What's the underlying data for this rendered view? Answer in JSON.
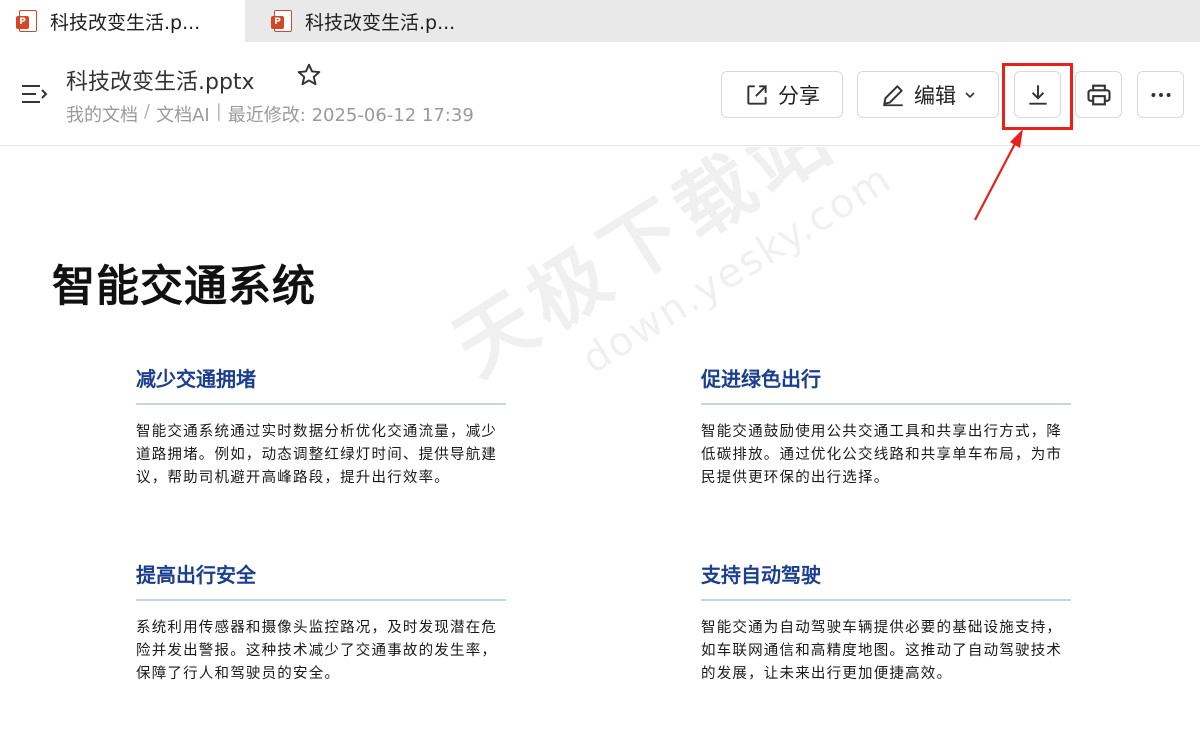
{
  "tabs": [
    {
      "label": "科技改变生活.p...",
      "icon": "powerpoint-file-icon"
    },
    {
      "label": "科技改变生活.p...",
      "icon": "powerpoint-file-icon"
    }
  ],
  "header": {
    "title": "科技改变生活.pptx",
    "breadcrumb": {
      "root": "我的文档",
      "sep1": "/",
      "folder": "文档AI",
      "sep2": "|",
      "modified": "最近修改: 2025-06-12 17:39"
    },
    "buttons": {
      "share": "分享",
      "edit": "编辑"
    }
  },
  "annotation": {
    "highlight_color": "#e8211a"
  },
  "slide": {
    "title": "智能交通系统",
    "sections": [
      {
        "heading": "减少交通拥堵",
        "body": "智能交通系统通过实时数据分析优化交通流量，减少道路拥堵。例如，动态调整红绿灯时间、提供导航建议，帮助司机避开高峰路段，提升出行效率。"
      },
      {
        "heading": "促进绿色出行",
        "body": "智能交通鼓励使用公共交通工具和共享出行方式，降低碳排放。通过优化公交线路和共享单车布局，为市民提供更环保的出行选择。"
      },
      {
        "heading": "提高出行安全",
        "body": "系统利用传感器和摄像头监控路况，及时发现潜在危险并发出警报。这种技术减少了交通事故的发生率，保障了行人和驾驶员的安全。"
      },
      {
        "heading": "支持自动驾驶",
        "body": "智能交通为自动驾驶车辆提供必要的基础设施支持，如车联网通信和高精度地图。这推动了自动驾驶技术的发展，让未来出行更加便捷高效。"
      }
    ],
    "heading_color": "#1b3f8e"
  },
  "watermark": {
    "text_big": "天极下载站",
    "text_small": "down.yesky.com"
  }
}
